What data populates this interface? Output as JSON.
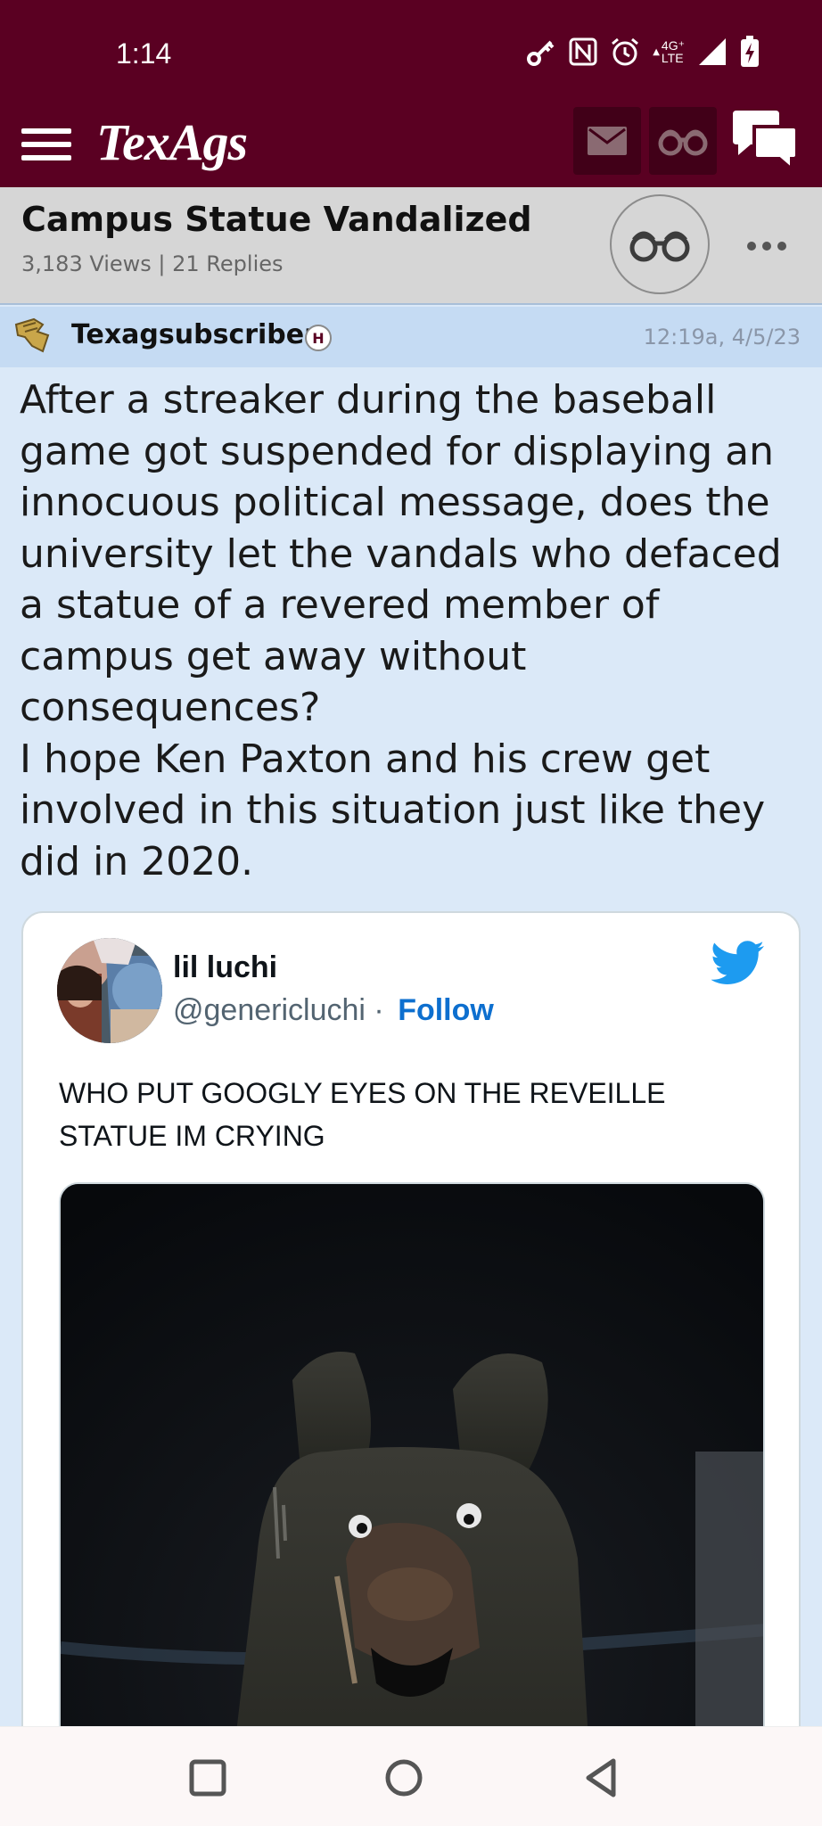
{
  "status_bar": {
    "time": "1:14",
    "icons": [
      "key-icon",
      "nfc-icon",
      "alarm-icon",
      "network-4g-lte-icon",
      "signal-icon",
      "battery-charging-icon"
    ],
    "network_label_top": "4G⁺",
    "network_label_bottom": "LTE"
  },
  "app_bar": {
    "logo": "TexAgs",
    "icons": [
      "menu-icon",
      "mail-icon",
      "binoculars-icon",
      "chat-bubbles-icon"
    ],
    "colors": {
      "brand": "#5a0022",
      "button": "#410018"
    }
  },
  "thread": {
    "title": "Campus Statue Vandalized",
    "meta": "3,183 Views | 21 Replies",
    "icons": [
      "binoculars-icon",
      "more-icon"
    ]
  },
  "post": {
    "author": "Texagsubscriber",
    "badge": "H",
    "timestamp": "12:19a, 4/5/23",
    "paragraph_1": "After a streaker during the baseball game got suspended for displaying an innocuous political message, does the university let the vandals who defaced a statue of a revered member of campus get away without consequences?",
    "paragraph_2": "I hope Ken Paxton and his crew get involved in this situation just like they did in 2020."
  },
  "tweet": {
    "name": "lil luchi",
    "handle": "@genericluchi",
    "separator": "·",
    "follow_label": "Follow",
    "text": "WHO PUT GOOGLY EYES ON THE REVEILLE STATUE IM CRYING",
    "icons": [
      "twitter-bird-icon"
    ],
    "colors": {
      "link": "#0d6fcf",
      "bird": "#1d9bf0"
    }
  },
  "nav_bar": {
    "icons": [
      "recents-icon",
      "home-icon",
      "back-icon"
    ]
  }
}
